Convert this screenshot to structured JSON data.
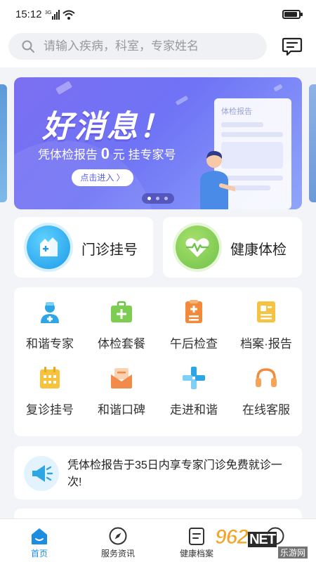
{
  "status_bar": {
    "time": "15:12",
    "network": "3G"
  },
  "search": {
    "placeholder": "请输入疾病，科室，专家姓名",
    "value": ""
  },
  "banner": {
    "title": "好消息！",
    "subtitle_prefix": "凭体检报告",
    "subtitle_amount": "0",
    "subtitle_suffix": "元  挂专家号",
    "cta": "点击进入 〉",
    "report_title": "体检报告",
    "slide_count": 3,
    "active_slide": 1
  },
  "quick_cards": [
    {
      "label": "门诊挂号",
      "icon": "hospital-icon"
    },
    {
      "label": "健康体检",
      "icon": "heartbeat-icon"
    }
  ],
  "services": [
    {
      "label": "和谐专家",
      "icon": "doctor-icon"
    },
    {
      "label": "体检套餐",
      "icon": "medical-kit-icon"
    },
    {
      "label": "午后检查",
      "icon": "clipboard-icon"
    },
    {
      "label": "档案·报告",
      "icon": "report-icon"
    },
    {
      "label": "复诊挂号",
      "icon": "calendar-icon"
    },
    {
      "label": "和谐口碑",
      "icon": "mail-icon"
    },
    {
      "label": "走进和谐",
      "icon": "hospital-cross-icon"
    },
    {
      "label": "在线客服",
      "icon": "headset-icon"
    }
  ],
  "notice": {
    "icon": "megaphone-icon",
    "text": "凭体检报告于35日内享专家门诊免费就诊一次!"
  },
  "bottom_nav": [
    {
      "label": "首页",
      "icon": "home-icon",
      "active": true
    },
    {
      "label": "服务资讯",
      "icon": "compass-icon",
      "active": false
    },
    {
      "label": "健康档案",
      "icon": "file-icon",
      "active": false
    },
    {
      "label": "",
      "icon": "user-icon",
      "active": false
    }
  ],
  "watermark": {
    "logo": "962",
    "logo_suffix": "NET",
    "sub": "乐游网"
  },
  "colors": {
    "accent": "#1d8de0",
    "banner_start": "#7c6ff2",
    "banner_end": "#8fa6fb",
    "outpatient": "#1e9ae8",
    "checkup": "#6fc24a"
  }
}
